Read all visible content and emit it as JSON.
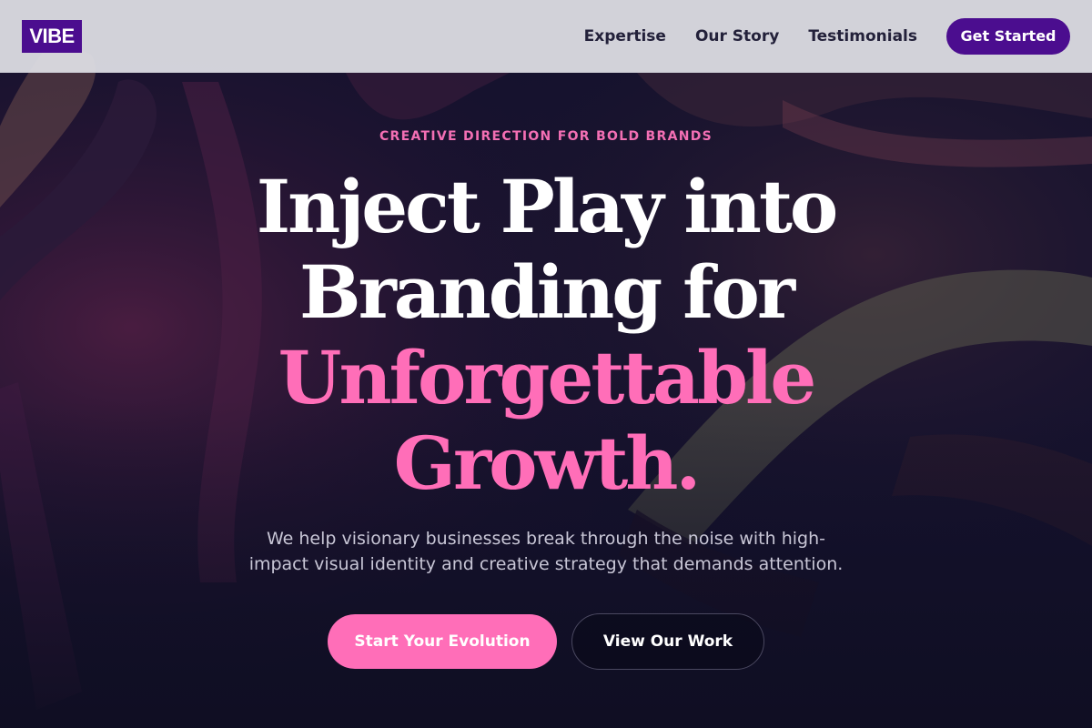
{
  "header": {
    "logo_text": "VIBE",
    "nav": [
      {
        "label": "Expertise"
      },
      {
        "label": "Our Story"
      },
      {
        "label": "Testimonials"
      }
    ],
    "cta_label": "Get Started"
  },
  "hero": {
    "eyebrow": "CREATIVE DIRECTION FOR BOLD BRANDS",
    "headline_lines": [
      "Inject Play into",
      "Branding for",
      "Unforgettable",
      "Growth."
    ],
    "subcopy": "We help visionary businesses break through the noise with high-impact visual identity and creative strategy that demands attention.",
    "primary_button": "Start Your Evolution",
    "secondary_button": "View Our Work"
  },
  "colors": {
    "brand_purple": "#4b0d8f",
    "accent_pink": "#ff6eb8",
    "hero_background": "#12102a"
  }
}
